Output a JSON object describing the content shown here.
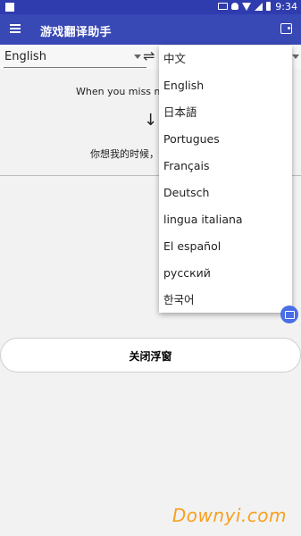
{
  "status_bar": {
    "time": "9:34"
  },
  "app_bar": {
    "title": "游戏翻译助手"
  },
  "translator": {
    "source_language": "English",
    "swap_symbol": "⇌",
    "source_text": "When you miss me",
    "arrow_symbol": "↓",
    "target_text": "你想我的时候，"
  },
  "language_menu": {
    "items": [
      "中文",
      "English",
      "日本語",
      "Portugues",
      "Français",
      "Deutsch",
      "lingua italiana",
      "El español",
      "русский",
      "한국어"
    ]
  },
  "actions": {
    "close_float_label": "关闭浮窗"
  },
  "watermark": {
    "text": "Downyi.com"
  },
  "colors": {
    "primary": "#3848b4",
    "status_bar": "#2f3cae",
    "fab": "#4a6ee6",
    "watermark": "#f7a020"
  }
}
